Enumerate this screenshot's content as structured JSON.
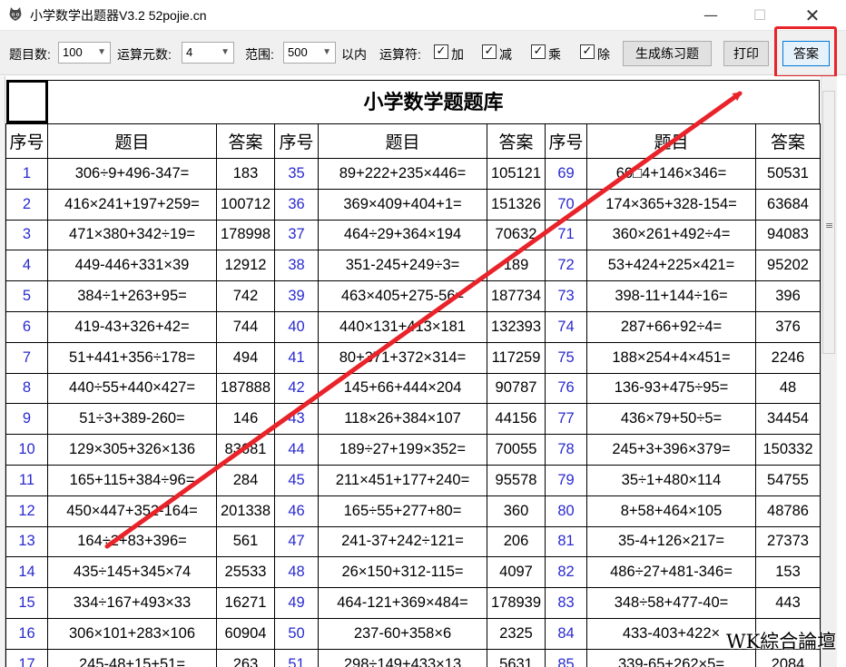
{
  "window": {
    "title": "小学数学出题器V3.2 52pojie.cn",
    "minimize_glyph": "—",
    "maximize_glyph": "☐",
    "close_glyph": "✕"
  },
  "toolbar": {
    "count_label": "题目数:",
    "count_value": "100",
    "operands_label": "运算元数:",
    "operands_value": "4",
    "range_label": "范围:",
    "range_value": "500",
    "range_suffix": "以内",
    "ops_label": "运算符:",
    "ops": [
      {
        "label": "加",
        "checked": true
      },
      {
        "label": "减",
        "checked": true
      },
      {
        "label": "乘",
        "checked": true
      },
      {
        "label": "除",
        "checked": true
      }
    ],
    "generate_label": "生成练习题",
    "print_label": "打印",
    "answer_label": "答案"
  },
  "sheet": {
    "title": "小学数学题题库",
    "headers": [
      "序号",
      "题目",
      "答案",
      "序号",
      "题目",
      "答案",
      "序号",
      "题目",
      "答案"
    ],
    "rows": [
      [
        "1",
        "306÷9+496-347=",
        "183",
        "35",
        "89+222+235×446=",
        "105121",
        "69",
        "60□4+146×346=",
        "50531"
      ],
      [
        "2",
        "416×241+197+259=",
        "100712",
        "36",
        "369×409+404+1=",
        "151326",
        "70",
        "174×365+328-154=",
        "63684"
      ],
      [
        "3",
        "471×380+342÷19=",
        "178998",
        "37",
        "464÷29+364×194",
        "70632",
        "71",
        "360×261+492÷4=",
        "94083"
      ],
      [
        "4",
        "449-446+331×39",
        "12912",
        "38",
        "351-245+249÷3=",
        "189",
        "72",
        "53+424+225×421=",
        "95202"
      ],
      [
        "5",
        "384÷1+263+95=",
        "742",
        "39",
        "463×405+275-56=",
        "187734",
        "73",
        "398-11+144÷16=",
        "396"
      ],
      [
        "6",
        "419-43+326+42=",
        "744",
        "40",
        "440×131+413×181",
        "132393",
        "74",
        "287+66+92÷4=",
        "376"
      ],
      [
        "7",
        "51+441+356÷178=",
        "494",
        "41",
        "80+371+372×314=",
        "117259",
        "75",
        "188×254+4×451=",
        "2246"
      ],
      [
        "8",
        "440÷55+440×427=",
        "187888",
        "42",
        "145+66+444×204",
        "90787",
        "76",
        "136-93+475÷95=",
        "48"
      ],
      [
        "9",
        "51÷3+389-260=",
        "146",
        "43",
        "118×26+384×107",
        "44156",
        "77",
        "436×79+50÷5=",
        "34454"
      ],
      [
        "10",
        "129×305+326×136",
        "83681",
        "44",
        "189÷27+199×352=",
        "70055",
        "78",
        "245+3+396×379=",
        "150332"
      ],
      [
        "11",
        "165+115+384÷96=",
        "284",
        "45",
        "211×451+177+240=",
        "95578",
        "79",
        "35÷1+480×114",
        "54755"
      ],
      [
        "12",
        "450×447+352-164=",
        "201338",
        "46",
        "165÷55+277+80=",
        "360",
        "80",
        "8+58+464×105",
        "48786"
      ],
      [
        "13",
        "164÷2+83+396=",
        "561",
        "47",
        "241-37+242÷121=",
        "206",
        "81",
        "35-4+126×217=",
        "27373"
      ],
      [
        "14",
        "435÷145+345×74",
        "25533",
        "48",
        "26×150+312-115=",
        "4097",
        "82",
        "486÷27+481-346=",
        "153"
      ],
      [
        "15",
        "334÷167+493×33",
        "16271",
        "49",
        "464-121+369×484=",
        "178939",
        "83",
        "348÷58+477-40=",
        "443"
      ],
      [
        "16",
        "306×101+283×106",
        "60904",
        "50",
        "237-60+358×6",
        "2325",
        "84",
        "433-403+422×",
        "",
        ""
      ],
      [
        "17",
        "245-48+15+51=",
        "263",
        "51",
        "298÷149+433×13",
        "5631",
        "85",
        "339-65+262×5=",
        "2084"
      ]
    ]
  },
  "watermark": "WK綜合論壇",
  "colors": {
    "accent_red": "#e8232a",
    "index_blue": "#2a2ad0"
  }
}
